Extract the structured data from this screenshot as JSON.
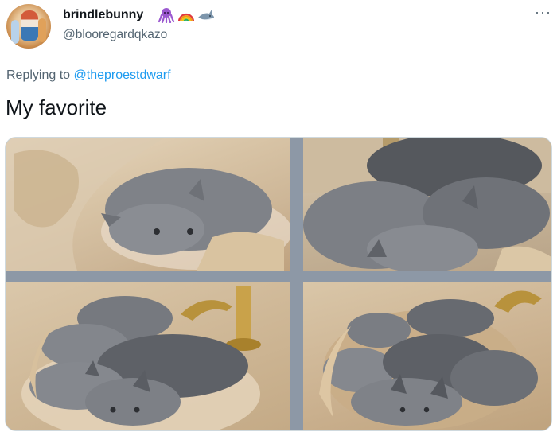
{
  "user": {
    "display_name": "brindlebunny",
    "handle": "@blooregardqkazo",
    "emojis": [
      "octopus-emoji",
      "rainbow-emoji",
      "shark-emoji"
    ]
  },
  "more_label": "···",
  "reply": {
    "prefix": "Replying to",
    "target": "@theproestdwarf"
  },
  "tweet": {
    "text": "My favorite"
  },
  "media": {
    "photos": [
      "kitten-photo-1",
      "kitten-photo-2",
      "kitten-photo-3",
      "kitten-photo-4"
    ]
  },
  "colors": {
    "text": "#0f1419",
    "secondary": "#536471",
    "link": "#1d9bf0",
    "kitten_gray": "#7f8288"
  }
}
